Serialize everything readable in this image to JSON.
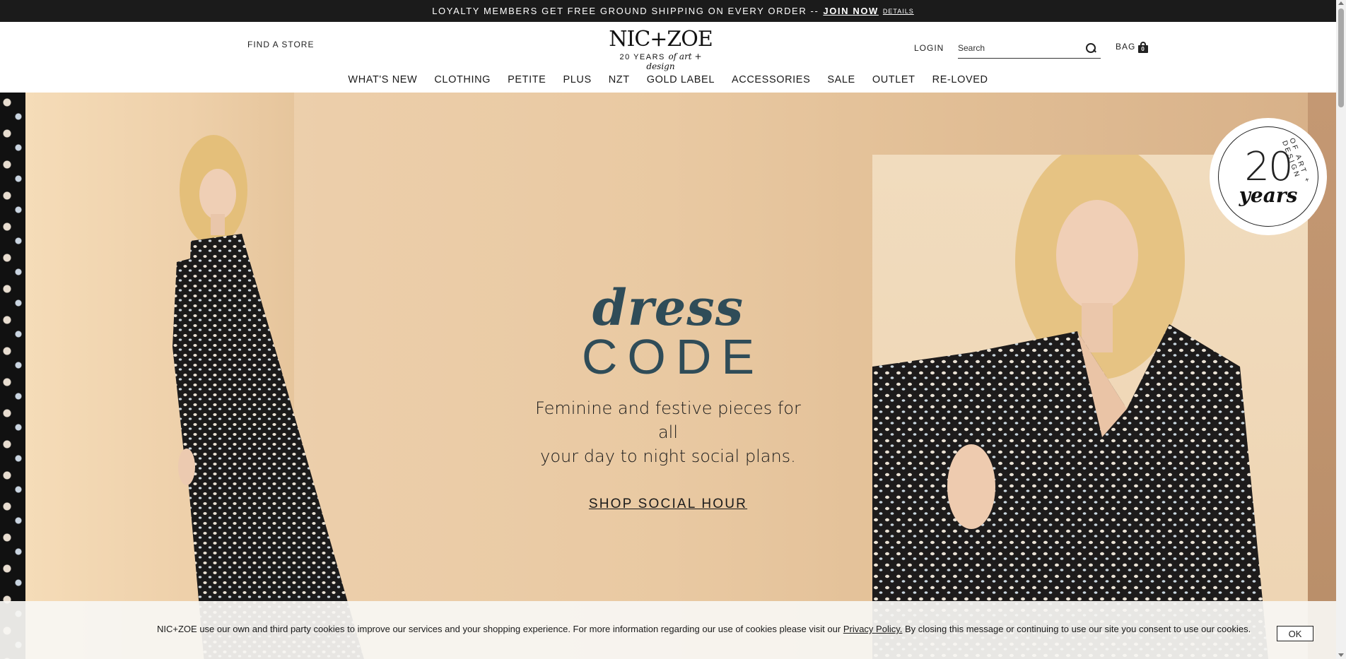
{
  "promo": {
    "text": "LOYALTY MEMBERS GET FREE GROUND SHIPPING ON EVERY ORDER --",
    "join_label": "JOIN NOW",
    "details_label": "DETAILS"
  },
  "header": {
    "find_store": "FIND A STORE",
    "logo_main": "NIC+ZOE",
    "logo_sub_prefix": "20 YEARS",
    "logo_sub_script": "of art + design",
    "login": "LOGIN",
    "search_placeholder": "Search",
    "bag_label": "BAG",
    "bag_count": "0"
  },
  "nav": {
    "items": [
      "WHAT'S NEW",
      "CLOTHING",
      "PETITE",
      "PLUS",
      "NZT",
      "GOLD LABEL",
      "ACCESSORIES",
      "SALE",
      "OUTLET",
      "RE-LOVED"
    ]
  },
  "hero": {
    "headline_script": "dress",
    "headline_caps": "CODE",
    "tagline_line1": "Feminine and festive pieces for all",
    "tagline_line2": "your day to night social plans.",
    "cta": "SHOP SOCIAL HOUR",
    "badge_number": "20",
    "badge_word": "years",
    "badge_ring": "OF ART + DESIGN",
    "headline_color": "#2f4c58"
  },
  "cookie": {
    "text_before": "NIC+ZOE use our own and third party cookies to improve our services and your shopping experience. For more information regarding our use of cookies please visit our",
    "policy_link": "Privacy Policy.",
    "text_after": "By closing this message or continuing to use our site you consent to use our cookies.",
    "ok_label": "OK"
  }
}
